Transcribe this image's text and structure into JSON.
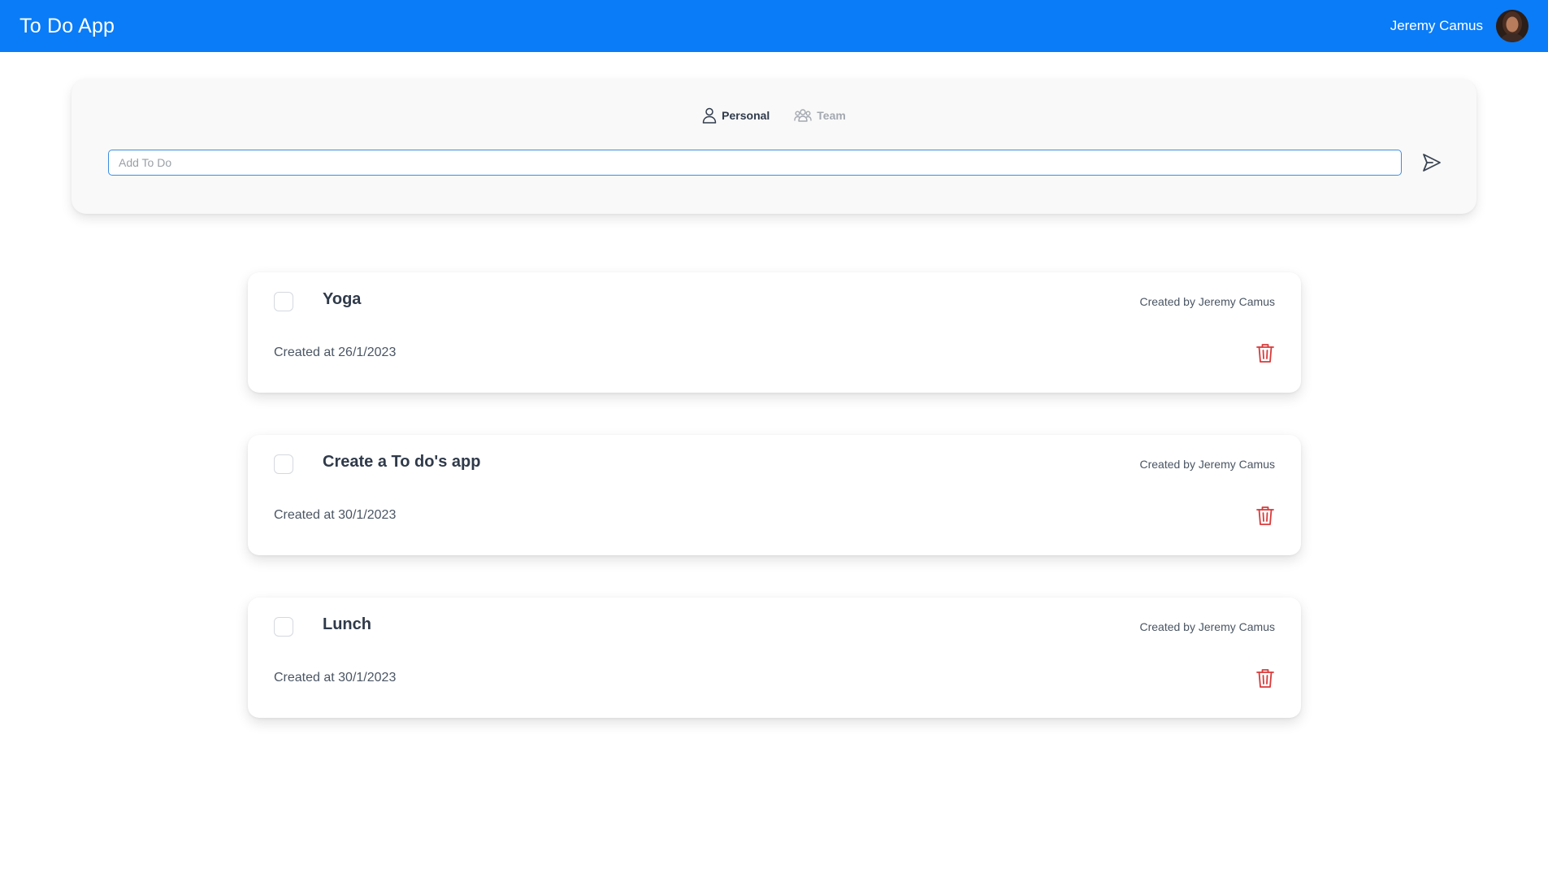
{
  "app": {
    "title": "To Do App"
  },
  "user": {
    "name": "Jeremy Camus"
  },
  "tabs": [
    {
      "label": "Personal",
      "icon": "user-icon",
      "active": true
    },
    {
      "label": "Team",
      "icon": "team-icon",
      "active": false
    }
  ],
  "composer": {
    "placeholder": "Add To Do",
    "value": "",
    "send_icon": "send-icon"
  },
  "todos": [
    {
      "title": "Yoga",
      "author": "Created by Jeremy Camus",
      "created": "Created at 26/1/2023",
      "checked": false
    },
    {
      "title": "Create a To do's app",
      "author": "Created by Jeremy Camus",
      "created": "Created at 30/1/2023",
      "checked": false
    },
    {
      "title": "Lunch",
      "author": "Created by Jeremy Camus",
      "created": "Created at 30/1/2023",
      "checked": false
    }
  ],
  "colors": {
    "navbar": "#0a7cf7",
    "delete": "#d93a3a",
    "text_dark": "#2f3a4a",
    "text_muted": "#a3a8b0"
  }
}
